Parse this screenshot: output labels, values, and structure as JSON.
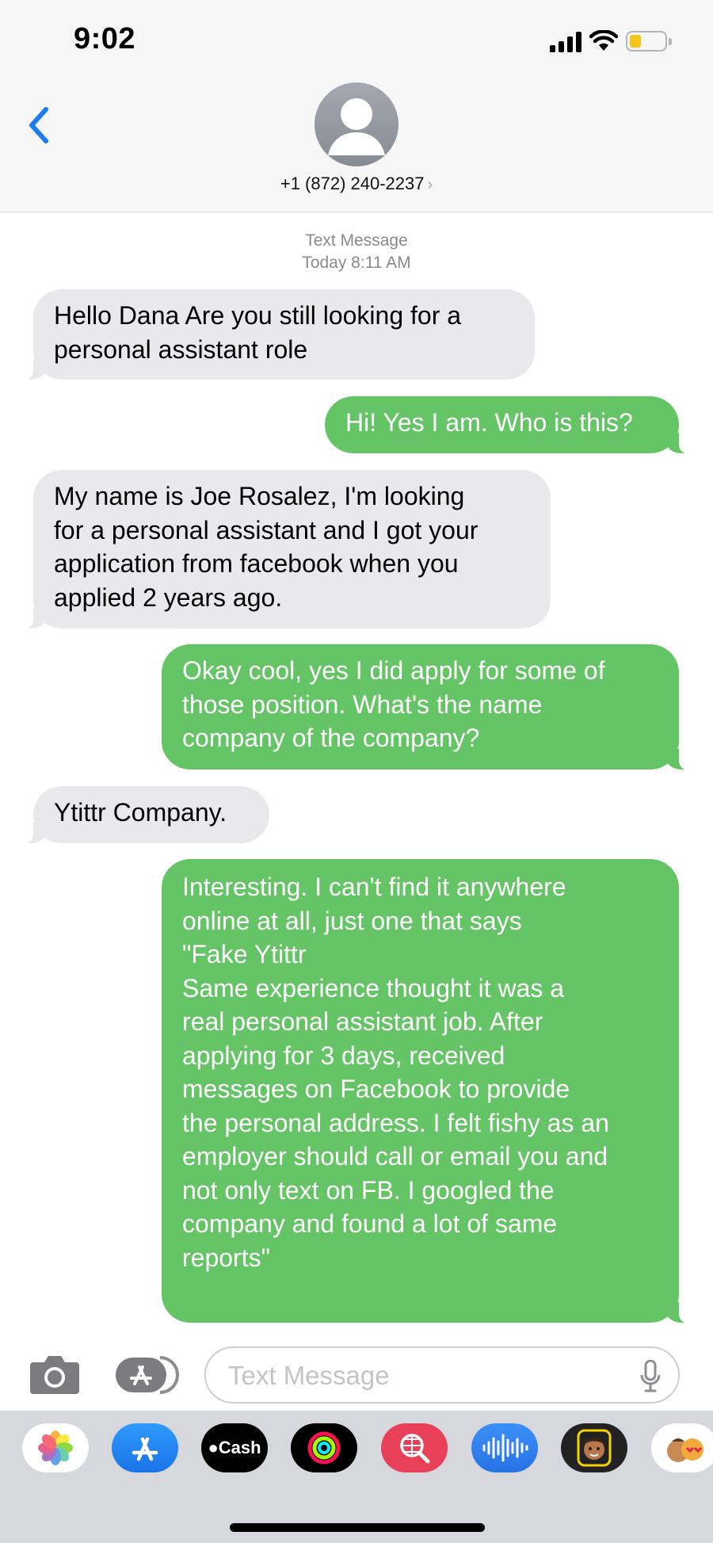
{
  "status_bar": {
    "time": "9:02"
  },
  "contact": {
    "name": "+1 (872) 240-2237",
    "chevron": "›"
  },
  "thread": {
    "service": "Text Message",
    "timestamp": "Today 8:11 AM",
    "messages": [
      {
        "direction": "incoming",
        "text": "Hello Dana Are you still looking for a\npersonal assistant role"
      },
      {
        "direction": "outgoing",
        "text": "Hi! Yes I am. Who is this?"
      },
      {
        "direction": "incoming",
        "text": "My name is Joe Rosalez, I'm looking\nfor a personal assistant and I got your\napplication from facebook when you\napplied 2 years ago."
      },
      {
        "direction": "outgoing",
        "text": "Okay cool, yes I did apply for some of\nthose position. What's the name\ncompany of the company?"
      },
      {
        "direction": "incoming",
        "text": "Ytittr Company."
      },
      {
        "direction": "outgoing",
        "text": "Interesting. I can't find it anywhere\nonline at all, just one that says\n\"Fake Ytittr\nSame experience thought it was a\nreal personal assistant job. After\napplying for 3 days, received\nmessages on Facebook to provide\nthe personal address. I felt fishy as an\nemployer should call or email you and\nnot only text on FB. I googled the\ncompany and found a lot of same\nreports\""
      }
    ]
  },
  "composer": {
    "placeholder": "Text Message"
  },
  "app_strip": {
    "icons": [
      "photos-icon",
      "app-store-icon",
      "apple-cash-icon",
      "activity-icon",
      "image-search-icon",
      "audio-message-icon",
      "memoji-icon",
      "animoji-icon"
    ],
    "cash_label": "Cash"
  },
  "colors": {
    "incoming": "#e9e9eb",
    "outgoing": "#65c466",
    "accent": "#1d7cf2"
  }
}
